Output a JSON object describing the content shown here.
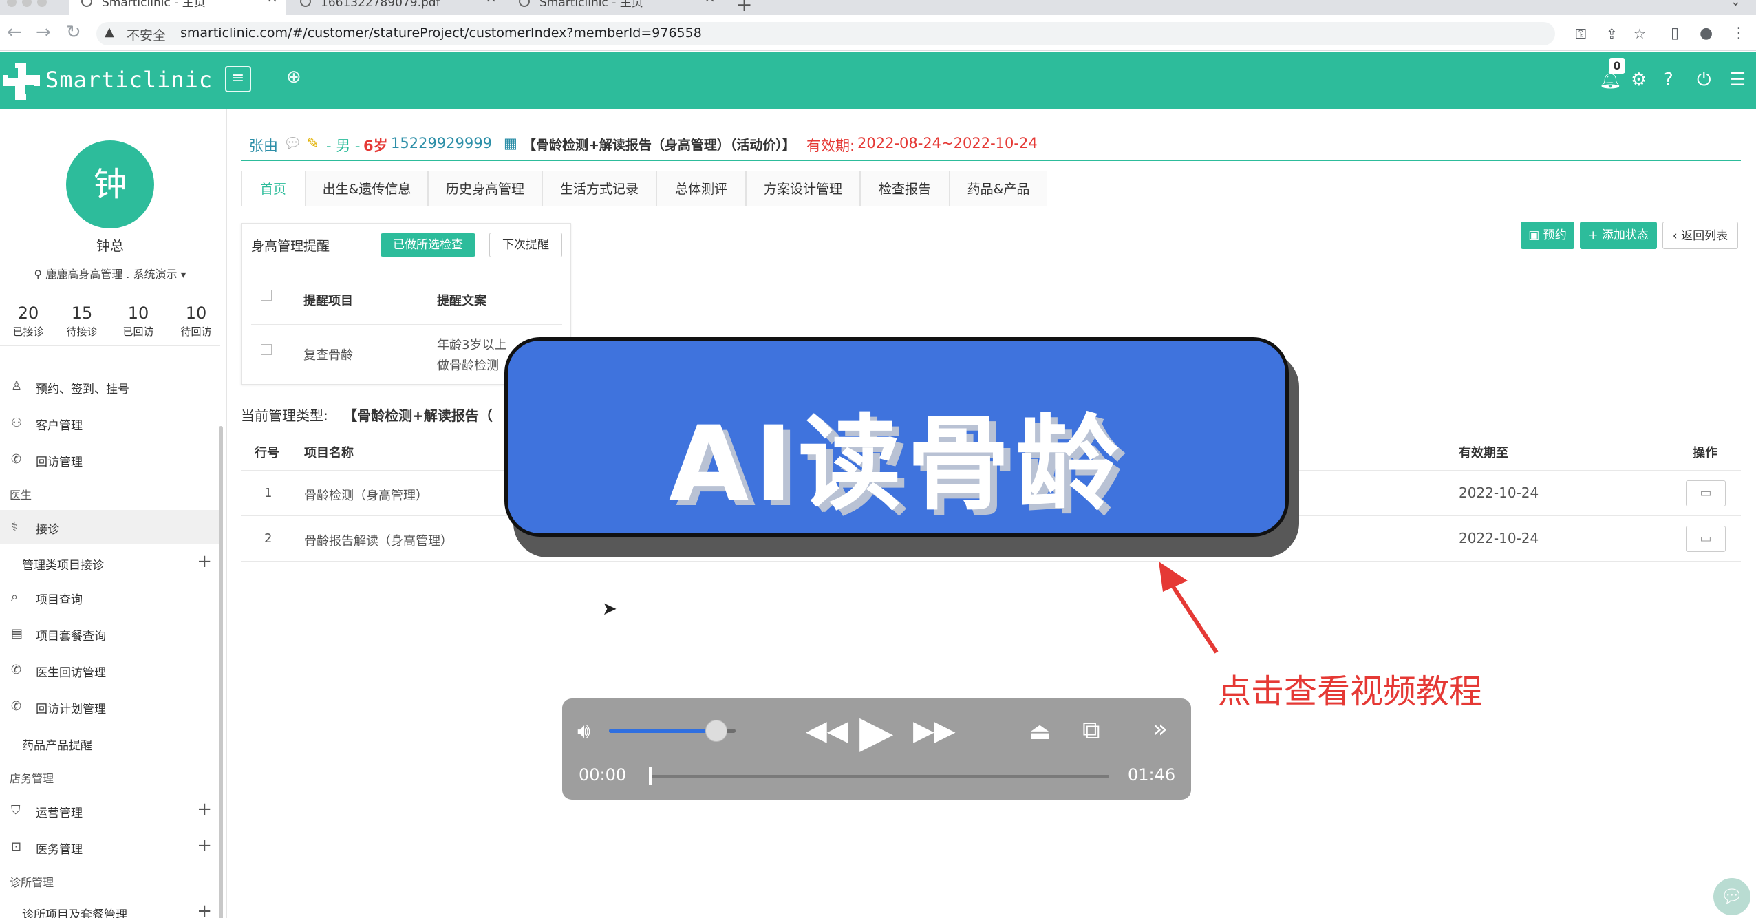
{
  "browser": {
    "tabs": [
      {
        "title": "Smarticlinic - 主页",
        "active": true
      },
      {
        "title": "1661322789079.pdf",
        "active": false
      },
      {
        "title": "Smarticlinic - 主页",
        "active": false
      }
    ],
    "security_label": "不安全",
    "url": "smarticlinic.com/#/customer/statureProject/customerIndex?memberId=976558"
  },
  "app": {
    "brand": "Smarticlinic",
    "brand_color": "#2dbc9b",
    "notification_count": "0"
  },
  "sidebar": {
    "avatar_char": "钟",
    "user_name": "钟总",
    "store": "鹿鹿高身高管理 . 系统演示",
    "stats": [
      {
        "value": "20",
        "label": "已接诊"
      },
      {
        "value": "15",
        "label": "待接诊"
      },
      {
        "value": "10",
        "label": "已回访"
      },
      {
        "value": "10",
        "label": "待回访"
      }
    ],
    "menu": [
      {
        "label": "预约、签到、挂号",
        "icon": "user-tag-icon",
        "type": "item"
      },
      {
        "label": "客户管理",
        "icon": "users-icon",
        "type": "item"
      },
      {
        "label": "回访管理",
        "icon": "phone-icon",
        "type": "item"
      },
      {
        "label": "医生",
        "type": "section"
      },
      {
        "label": "接诊",
        "icon": "stethoscope-icon",
        "type": "item",
        "active": true
      },
      {
        "label": "管理类项目接诊",
        "type": "sub",
        "expand": true
      },
      {
        "label": "项目查询",
        "icon": "search-icon",
        "type": "item"
      },
      {
        "label": "项目套餐查询",
        "icon": "list-search-icon",
        "type": "item"
      },
      {
        "label": "医生回访管理",
        "icon": "phone-icon",
        "type": "item"
      },
      {
        "label": "回访计划管理",
        "icon": "phone-icon",
        "type": "item"
      },
      {
        "label": "药品产品提醒",
        "type": "sub"
      },
      {
        "label": "店务管理",
        "type": "section"
      },
      {
        "label": "运营管理",
        "icon": "shield-icon",
        "type": "item",
        "expand": true
      },
      {
        "label": "医务管理",
        "icon": "medical-box-icon",
        "type": "item",
        "expand": true
      },
      {
        "label": "诊所管理",
        "type": "section"
      },
      {
        "label": "诊所项目及套餐管理",
        "type": "sub",
        "expand": true
      }
    ]
  },
  "patient": {
    "name": "张由",
    "gender": "- 男 -",
    "age": "6岁",
    "phone": "15229929999",
    "package": "【骨龄检测+解读报告（身高管理）（活动价）】",
    "validity_label": "有效期:",
    "validity": "2022-08-24~2022-10-24"
  },
  "tabs": [
    "首页",
    "出生&遗传信息",
    "历史身高管理",
    "生活方式记录",
    "总体测评",
    "方案设计管理",
    "检查报告",
    "药品&产品"
  ],
  "actions": {
    "appointment": "预约",
    "add_status": "添加状态",
    "back_to_list": "返回列表"
  },
  "reminder": {
    "title": "身高管理提醒",
    "done_btn": "已做所选检查",
    "next_btn": "下次提醒",
    "headers": [
      "提醒项目",
      "提醒文案"
    ],
    "rows": [
      {
        "item": "复查骨龄",
        "text_line1": "年龄3岁以上",
        "text_line2": "做骨龄检测"
      }
    ]
  },
  "management": {
    "label": "当前管理类型:",
    "value": "【骨龄检测+解读报告（"
  },
  "grid": {
    "headers": {
      "row": "行号",
      "name": "项目名称",
      "valid_until": "有效期至",
      "action": "操作"
    },
    "rows": [
      {
        "no": "1",
        "name": "骨龄检测（身高管理）",
        "valid_until": "2022-10-24"
      },
      {
        "no": "2",
        "name": "骨龄报告解读（身高管理）",
        "valid_until": "2022-10-24"
      }
    ]
  },
  "overlay": {
    "banner_text": "AI读骨龄",
    "banner_color": "#3f73dd",
    "hint_text": "点击查看视频教程",
    "hint_color": "#e53935"
  },
  "player": {
    "current_time": "00:00",
    "duration": "01:46",
    "volume": 0.85,
    "progress": 0
  }
}
